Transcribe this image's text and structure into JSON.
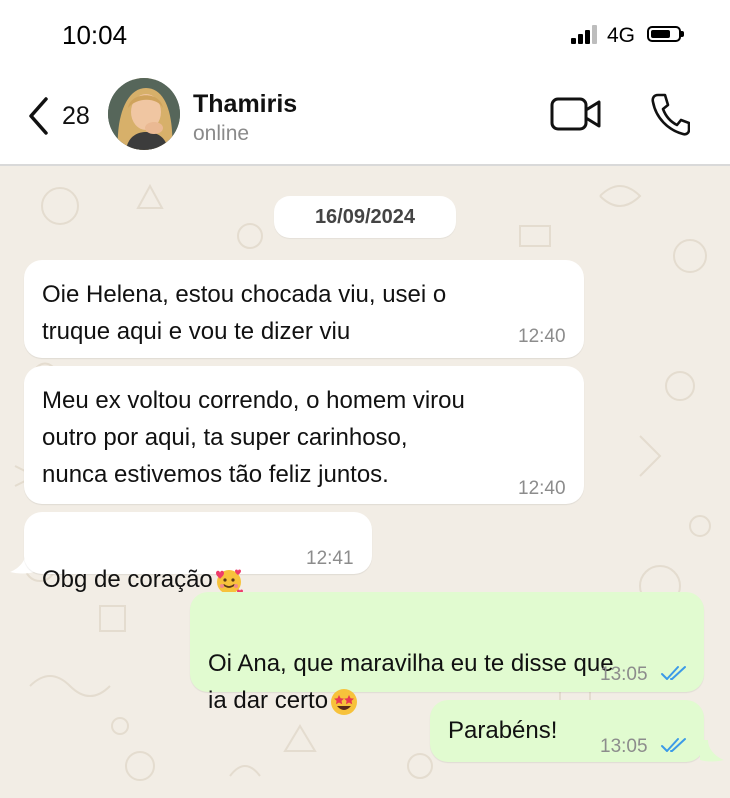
{
  "status_bar": {
    "time": "10:04",
    "network": "4G",
    "icons": [
      "signal-icon",
      "battery-icon"
    ]
  },
  "header": {
    "back_count": "28",
    "contact_name": "Thamiris",
    "contact_status": "online",
    "icons": [
      "chevron-left-icon",
      "video-call-icon",
      "phone-icon"
    ]
  },
  "chat": {
    "date": "16/09/2024",
    "messages": [
      {
        "direction": "incoming",
        "text": "Oie Helena, estou chocada viu, usei o\ntruque aqui e vou te dizer viu",
        "time": "12:40"
      },
      {
        "direction": "incoming",
        "text": "Meu ex voltou correndo, o homem virou\noutro por aqui, ta super carinhoso,\nnunca estivemos tão feliz juntos.",
        "time": "12:40"
      },
      {
        "direction": "incoming",
        "text": "Obg de coração",
        "emoji": "smiling-face-with-hearts-emoji",
        "time": "12:41"
      },
      {
        "direction": "outgoing",
        "text": "Oi Ana, que maravilha eu te disse que\nia dar certo",
        "emoji": "star-struck-emoji",
        "time": "13:05",
        "read": true
      },
      {
        "direction": "outgoing",
        "text": "Parabéns!",
        "time": "13:05",
        "read": true
      }
    ]
  },
  "colors": {
    "chat_background": "#f2ede5",
    "incoming_bubble": "#ffffff",
    "outgoing_bubble": "#e1fbd0",
    "read_ticks": "#3b9ae8"
  }
}
